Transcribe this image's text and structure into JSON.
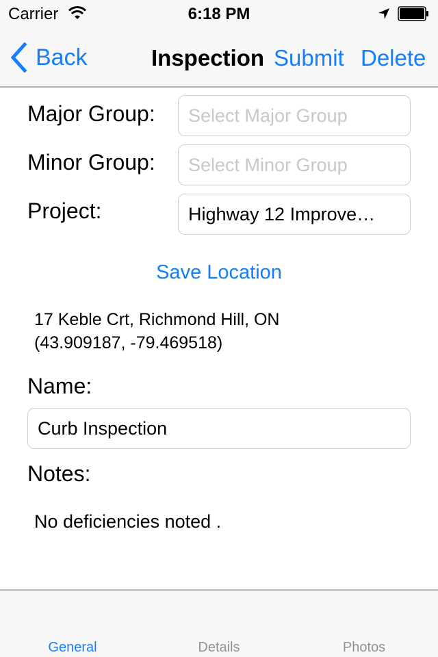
{
  "status_bar": {
    "carrier": "Carrier",
    "time": "6:18 PM",
    "icons": [
      "wifi-icon",
      "location-arrow-icon",
      "battery-icon"
    ]
  },
  "nav_bar": {
    "back_label": "Back",
    "title": "Inspection",
    "submit_label": "Submit",
    "delete_label": "Delete"
  },
  "form": {
    "major_group": {
      "label": "Major Group:",
      "value": "",
      "placeholder": "Select Major Group"
    },
    "minor_group": {
      "label": "Minor Group:",
      "value": "",
      "placeholder": "Select Minor Group"
    },
    "project": {
      "label": "Project:",
      "value": "Highway 12 Improve…"
    },
    "save_location_label": "Save Location",
    "address_line": "17 Keble Crt, Richmond Hill, ON",
    "coordinates": "(43.909187, -79.469518)",
    "name": {
      "label": "Name:",
      "value": "Curb Inspection"
    },
    "notes": {
      "label": "Notes:",
      "value": "No deficiencies noted ."
    }
  },
  "tab_bar": {
    "tabs": [
      {
        "label": "General",
        "active": true
      },
      {
        "label": "Details",
        "active": false
      },
      {
        "label": "Photos",
        "active": false
      }
    ]
  },
  "colors": {
    "accent": "#157efb",
    "placeholder": "#c7c7cd",
    "inactive_tab": "#929292",
    "bar_background": "#f7f7f7"
  }
}
